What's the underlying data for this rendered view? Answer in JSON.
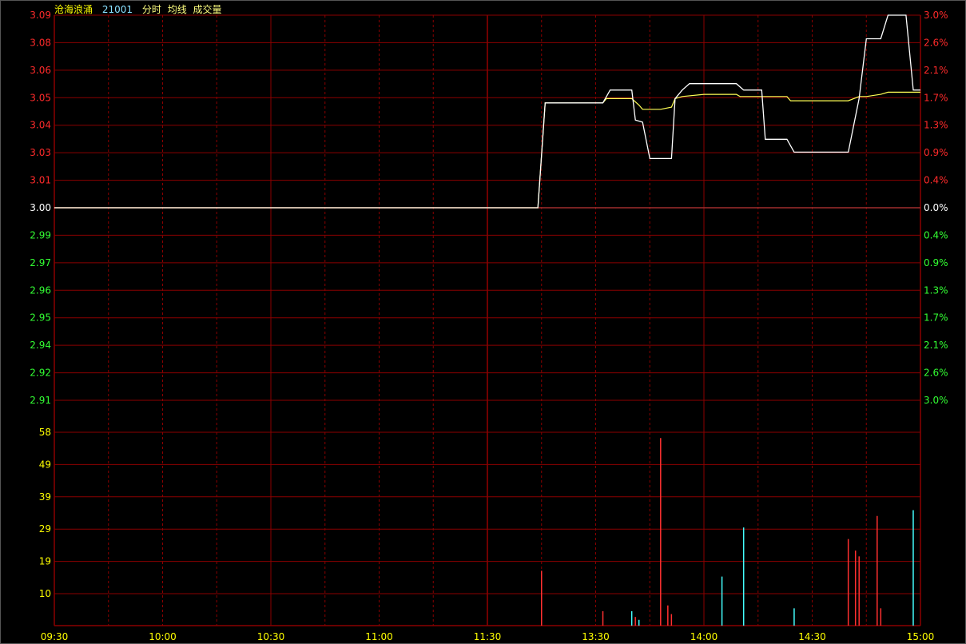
{
  "header": {
    "name": "沧海浪涌",
    "code": "21001",
    "mode": "分时",
    "avg_label": "均线",
    "vol_label": "成交量"
  },
  "colors": {
    "background": "#000000",
    "grid": "#8b0000",
    "up": "#ff2a2a",
    "down": "#33ff33",
    "flat": "#ffffff",
    "price_line": "#ffffff",
    "avg_line": "#ffff55",
    "volume_label": "#ffff00",
    "vol_up": "#ff3030",
    "vol_down": "#44ffff",
    "time_label": "#ffff00",
    "header_name": "#ffff00",
    "header_code": "#88e0ff",
    "header_text": "#ffff80"
  },
  "chart_data": {
    "type": "line",
    "prev_close": 3.0,
    "price_ticks": [
      "3.09",
      "3.08",
      "3.06",
      "3.05",
      "3.04",
      "3.03",
      "3.01",
      "3.00",
      "2.99",
      "2.97",
      "2.96",
      "2.95",
      "2.94",
      "2.92",
      "2.91"
    ],
    "percent_ticks": [
      "3.0%",
      "2.6%",
      "2.1%",
      "1.7%",
      "1.3%",
      "0.9%",
      "0.4%",
      "0.0%",
      "0.4%",
      "0.9%",
      "1.3%",
      "1.7%",
      "2.1%",
      "2.6%",
      "3.0%"
    ],
    "volume_ticks": [
      "58",
      "49",
      "39",
      "29",
      "19",
      "10"
    ],
    "ylim_price": [
      2.91,
      3.09
    ],
    "ylim_volume": [
      0,
      67
    ],
    "time_labels": [
      "09:30",
      "10:00",
      "10:30",
      "11:00",
      "11:30",
      "13:30",
      "14:00",
      "14:30",
      "15:00"
    ],
    "time_range": [
      0,
      240
    ],
    "price_series": {
      "name": "",
      "points": [
        [
          0,
          3.0
        ],
        [
          134,
          3.0
        ],
        [
          136,
          3.049
        ],
        [
          152,
          3.049
        ],
        [
          154,
          3.055
        ],
        [
          160,
          3.055
        ],
        [
          161,
          3.041
        ],
        [
          163,
          3.04
        ],
        [
          165,
          3.023
        ],
        [
          171,
          3.023
        ],
        [
          172,
          3.051
        ],
        [
          174,
          3.055
        ],
        [
          176,
          3.058
        ],
        [
          189,
          3.058
        ],
        [
          191,
          3.055
        ],
        [
          196,
          3.055
        ],
        [
          197,
          3.032
        ],
        [
          203,
          3.032
        ],
        [
          205,
          3.026
        ],
        [
          220,
          3.026
        ],
        [
          223,
          3.051
        ],
        [
          225,
          3.079
        ],
        [
          229,
          3.079
        ],
        [
          231,
          3.09
        ],
        [
          236,
          3.09
        ],
        [
          238,
          3.055
        ],
        [
          240,
          3.055
        ]
      ]
    },
    "avg_series": {
      "name": "",
      "points": [
        [
          0,
          3.0
        ],
        [
          134,
          3.0
        ],
        [
          136,
          3.049
        ],
        [
          152,
          3.049
        ],
        [
          153,
          3.051
        ],
        [
          160,
          3.051
        ],
        [
          162,
          3.048
        ],
        [
          163,
          3.046
        ],
        [
          168,
          3.046
        ],
        [
          171,
          3.047
        ],
        [
          172,
          3.051
        ],
        [
          174,
          3.052
        ],
        [
          180,
          3.053
        ],
        [
          189,
          3.053
        ],
        [
          190,
          3.052
        ],
        [
          196,
          3.052
        ],
        [
          203,
          3.052
        ],
        [
          204,
          3.05
        ],
        [
          220,
          3.05
        ],
        [
          223,
          3.052
        ],
        [
          225,
          3.052
        ],
        [
          229,
          3.053
        ],
        [
          231,
          3.054
        ],
        [
          240,
          3.054
        ]
      ]
    },
    "volume_bars": [
      {
        "t": 135,
        "v": 19,
        "dir": "up"
      },
      {
        "t": 152,
        "v": 5,
        "dir": "up"
      },
      {
        "t": 160,
        "v": 5,
        "dir": "down"
      },
      {
        "t": 161,
        "v": 3,
        "dir": "up"
      },
      {
        "t": 162,
        "v": 2,
        "dir": "down"
      },
      {
        "t": 168,
        "v": 65,
        "dir": "up"
      },
      {
        "t": 170,
        "v": 7,
        "dir": "up"
      },
      {
        "t": 171,
        "v": 4,
        "dir": "up"
      },
      {
        "t": 185,
        "v": 17,
        "dir": "down"
      },
      {
        "t": 191,
        "v": 34,
        "dir": "down"
      },
      {
        "t": 205,
        "v": 6,
        "dir": "down"
      },
      {
        "t": 220,
        "v": 30,
        "dir": "up"
      },
      {
        "t": 222,
        "v": 26,
        "dir": "up"
      },
      {
        "t": 223,
        "v": 24,
        "dir": "up"
      },
      {
        "t": 228,
        "v": 38,
        "dir": "up"
      },
      {
        "t": 229,
        "v": 6,
        "dir": "up"
      },
      {
        "t": 238,
        "v": 40,
        "dir": "down"
      }
    ]
  }
}
